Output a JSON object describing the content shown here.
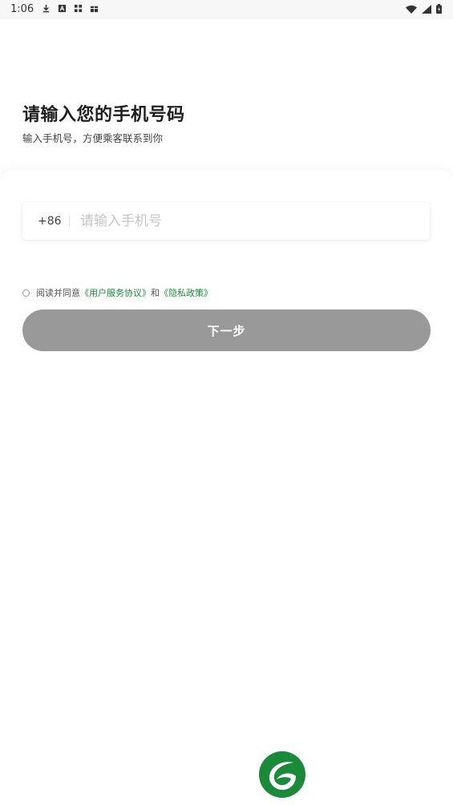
{
  "status_bar": {
    "time": "1:06",
    "left_icons": [
      "download-icon",
      "a-icon",
      "app-icon",
      "gift-icon"
    ],
    "right_icons": [
      "wifi-icon",
      "signal-icon",
      "battery-icon"
    ]
  },
  "header": {
    "title": "请输入您的手机号码",
    "subtitle": "输入手机号，方便乘客联系到你"
  },
  "phone_field": {
    "prefix": "+86",
    "placeholder": "请输入手机号",
    "value": ""
  },
  "agreement": {
    "prefix_text": "阅读并同意",
    "user_agreement": "《用户服务协议》",
    "connector": "和",
    "privacy_policy": "《隐私政策》",
    "checked": false
  },
  "next_button": {
    "label": "下一步"
  },
  "colors": {
    "brand_green": "#1a8a3a",
    "button_disabled": "#999999"
  },
  "logo_icon": "leaf-logo-icon"
}
